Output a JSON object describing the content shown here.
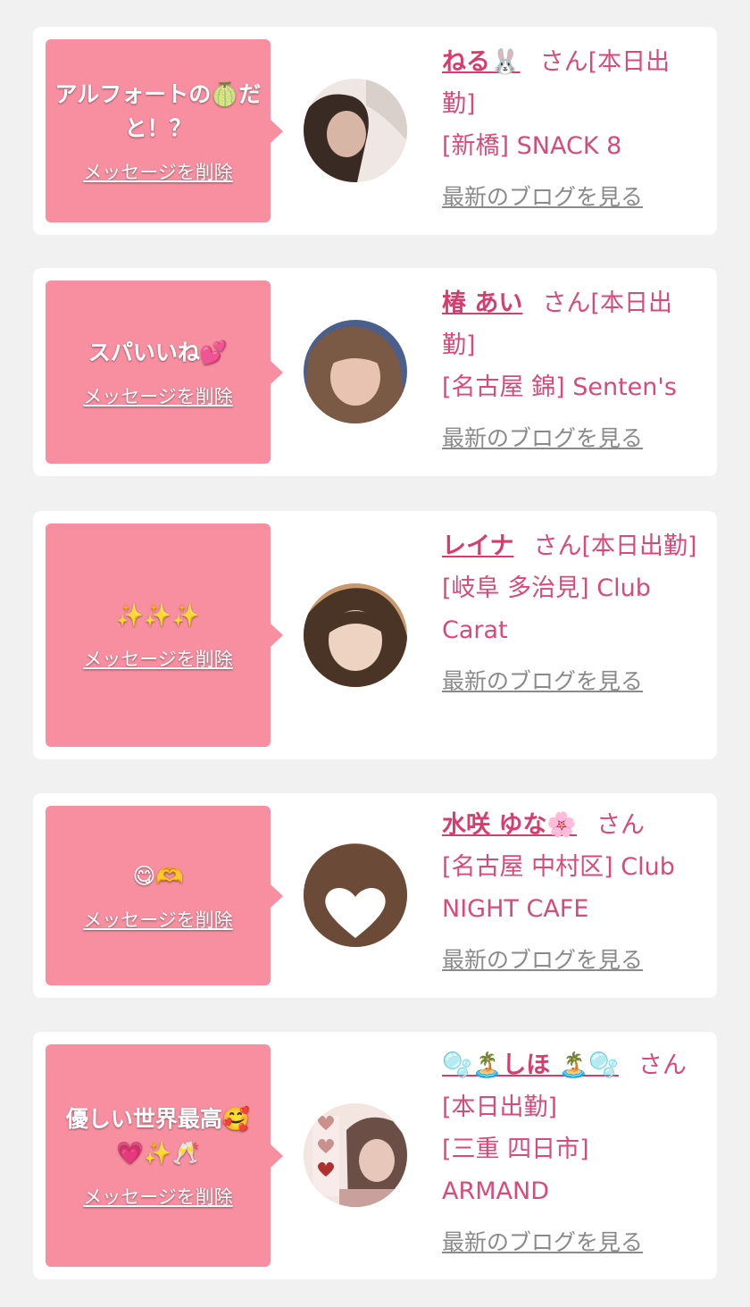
{
  "cards": [
    {
      "message": "アルフォートの🍈だと！？",
      "delete_label": "メッセージを削除",
      "name": "ねる🐰",
      "suffix": "さん[本日出勤]",
      "store": "[新橋] SNACK 8",
      "blog_label": "最新のブログを見る",
      "avatar_colors": [
        "#3a2a24",
        "#d8b6a6",
        "#efe7e3"
      ]
    },
    {
      "message": "スパいいね💕",
      "delete_label": "メッセージを削除",
      "name": "椿 あい",
      "suffix": "さん[本日出勤]",
      "store": "[名古屋 錦] Senten's",
      "blog_label": "最新のブログを見る",
      "avatar_colors": [
        "#7a5a44",
        "#e8c3b1",
        "#4a5f8c"
      ]
    },
    {
      "message": "✨✨✨",
      "delete_label": "メッセージを削除",
      "name": "レイナ",
      "suffix": "さん[本日出勤]",
      "store": "[岐阜 多治見] Club Carat",
      "blog_label": "最新のブログを見る",
      "avatar_colors": [
        "#4a3426",
        "#efd3c2",
        "#c89a6e"
      ]
    },
    {
      "message": "😋🫶",
      "delete_label": "メッセージを削除",
      "name": "水咲 ゆな🌸",
      "suffix": "さん",
      "store": "[名古屋 中村区] Club NIGHT CAFE",
      "blog_label": "最新のブログを見る",
      "avatar_colors": [
        "#6b4a38",
        "#b08670",
        "#ffffff"
      ]
    },
    {
      "message": "優しい世界最高🥰💗✨🥂",
      "delete_label": "メッセージを削除",
      "name": "🫧🏝️しほ 🏝️🫧",
      "suffix": "さん[本日出勤]",
      "store": "[三重 四日市] ARMAND",
      "blog_label": "最新のブログを見る",
      "avatar_colors": [
        "#f3e5e0",
        "#c9908c",
        "#6b4e46"
      ]
    }
  ]
}
